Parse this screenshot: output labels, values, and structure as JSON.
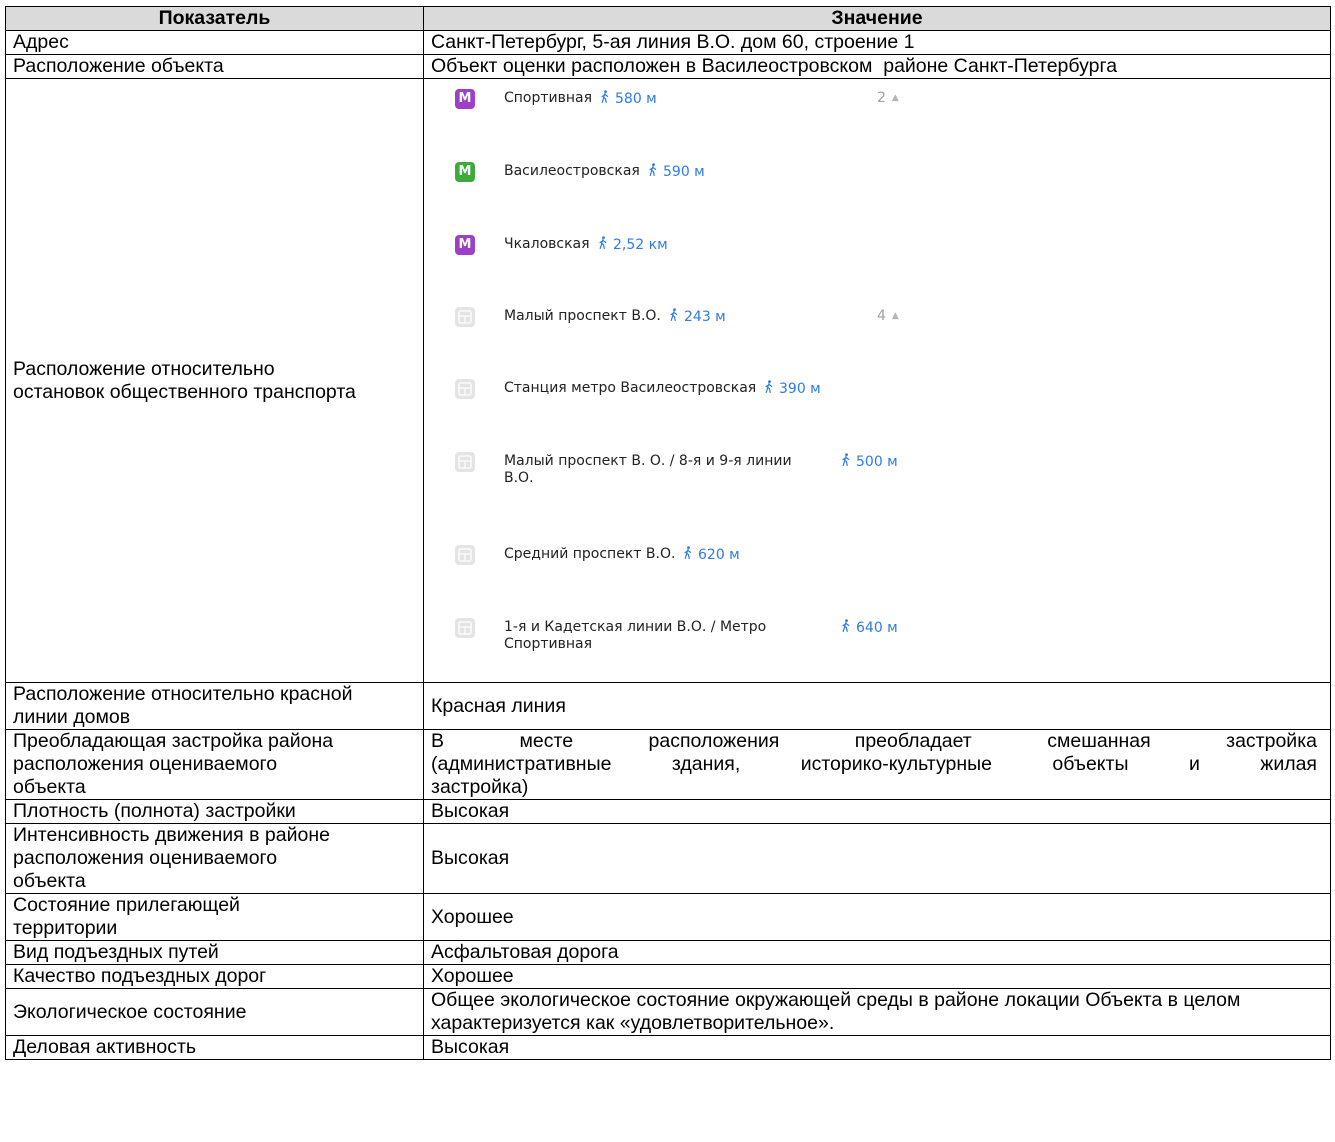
{
  "table": {
    "header": {
      "col1": "Показатель",
      "col2": "Значение"
    },
    "address": {
      "label": "Адрес",
      "value": "Санкт-Петербург, 5-ая линия В.О. дом 60, строение 1"
    },
    "location": {
      "label": "Расположение объекта",
      "value": "Объект оценки расположен в Василеостровском  районе Санкт-Петербурга"
    },
    "transport": {
      "label": "Расположение относительно остановок общественного транспорта",
      "stops": [
        {
          "type": "metro",
          "color": "#9d3fc8",
          "icon": "metro-icon",
          "badge": "М",
          "name": "Спортивная",
          "distance": "580 м",
          "count": "2"
        },
        {
          "type": "metro",
          "color": "#3cab3c",
          "icon": "metro-icon",
          "badge": "М",
          "name": "Василеостровская",
          "distance": "590 м"
        },
        {
          "type": "metro",
          "color": "#9d3fc8",
          "icon": "metro-icon",
          "badge": "М",
          "name": "Чкаловская",
          "distance": "2,52 км"
        },
        {
          "type": "bus",
          "icon": "bus-stop-icon",
          "name": "Малый проспект В.О.",
          "distance": "243 м",
          "count": "4"
        },
        {
          "type": "bus",
          "icon": "bus-stop-icon",
          "name": "Станция метро Василеостровская",
          "distance": "390 м"
        },
        {
          "type": "bus",
          "icon": "bus-stop-icon",
          "name": "Малый проспект В. О. / 8-я и 9-я линии В.О.",
          "distance": "500 м"
        },
        {
          "type": "bus",
          "icon": "bus-stop-icon",
          "name": "Средний проспект В.О.",
          "distance": "620 м"
        },
        {
          "type": "bus",
          "icon": "bus-stop-icon",
          "name": "1-я и Кадетская линии В.О. / Метро Спортивная",
          "distance": "640 м"
        }
      ]
    },
    "red_line": {
      "label": "Расположение относительно красной линии домов",
      "value": "Красная линия"
    },
    "development": {
      "label": "Преобладающая застройка района расположения оцениваемого объекта",
      "value_line1": "В месте расположения преобладает смешанная застройка",
      "value_line2": "(административные здания, историко-культурные объекты и жилая",
      "value_line3": "застройка)"
    },
    "density": {
      "label": "Плотность (полнота) застройки",
      "value": "Высокая"
    },
    "traffic": {
      "label": "Интенсивность движения в районе расположения оцениваемого объекта",
      "value": "Высокая"
    },
    "territory": {
      "label": "Состояние прилегающей территории",
      "value": "Хорошее"
    },
    "access_type": {
      "label": "Вид подъездных путей",
      "value": "Асфальтовая дорога"
    },
    "road_quality": {
      "label": "Качество подъездных дорог",
      "value": "Хорошее"
    },
    "ecology": {
      "label": "Экологическое состояние",
      "value": "Общее экологическое состояние окружающей среды в районе локации Объекта в целом характеризуется как «удовлетворительное»."
    },
    "business": {
      "label": "Деловая активность",
      "value": "Высокая"
    }
  }
}
